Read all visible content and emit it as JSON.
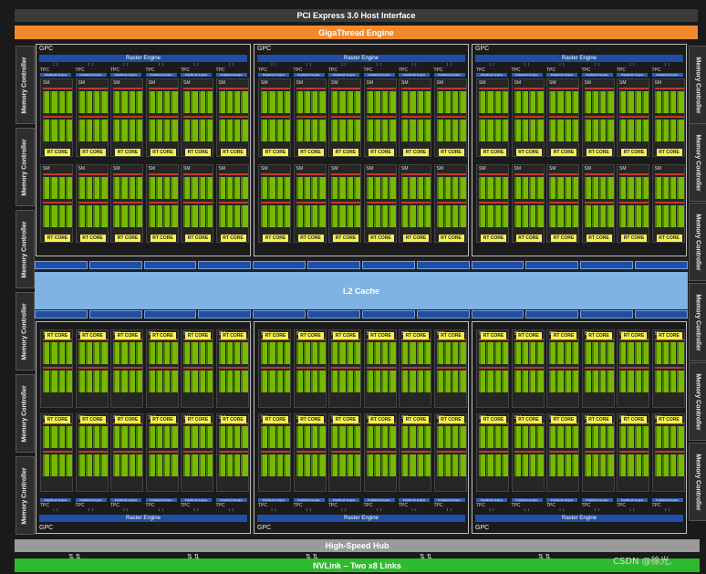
{
  "header": {
    "pcie": "PCI Express 3.0 Host Interface",
    "gigathread": "GigaThread Engine"
  },
  "memory_controller_label": "Memory Controller",
  "gpc": {
    "label": "GPC",
    "raster": "Raster Engine",
    "tpc": "TPC",
    "polymorph": "PolyMorph Engine",
    "sm": "SM",
    "rt_core": "RT CORE"
  },
  "l2": "L2 Cache",
  "footer": {
    "hub": "High-Speed Hub",
    "nvlink": "NVLink – Two x8 Links"
  },
  "watermark": "CSDN @徐光.",
  "colors": {
    "pcie": "#3a3a3a",
    "gigathread": "#f28a2c",
    "l2": "#7fb3e3",
    "hub": "#9a9a9a",
    "nvlink": "#2dbb2d",
    "cuda_core": "#76b900",
    "rt_core": "#f5f251",
    "raster": "#1f4ea8"
  }
}
